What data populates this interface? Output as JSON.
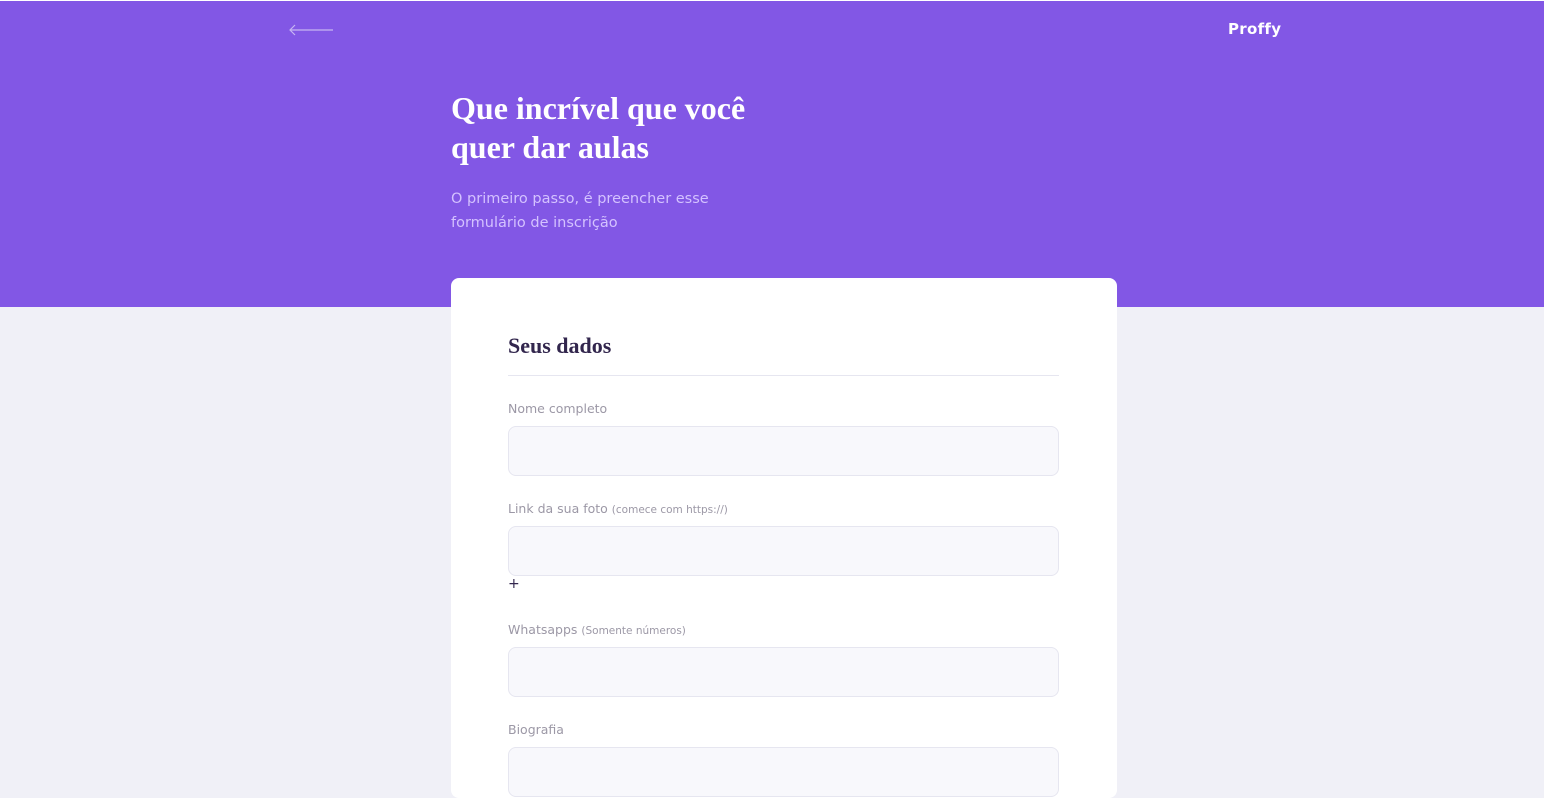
{
  "header": {
    "back_icon": "arrow-left-icon",
    "logo": "Proffy",
    "title_line1": "Que incrível que você",
    "title_line2": "quer dar aulas",
    "subtitle_line1": "O primeiro passo, é preencher esse",
    "subtitle_line2": "formulário de inscrição"
  },
  "form": {
    "section_title": "Seus dados",
    "fields": [
      {
        "label": "Nome completo",
        "hint": "",
        "value": ""
      },
      {
        "label": "Link da sua foto",
        "hint": "(comece com https://)",
        "value": ""
      },
      {
        "label": "Whatsapps",
        "hint": "(Somente números)",
        "value": ""
      },
      {
        "label": "Biografia",
        "hint": "",
        "value": ""
      }
    ],
    "add_label": "+"
  },
  "colors": {
    "primary": "#8257E5",
    "background": "#F0F0F7",
    "card": "#FFFFFF",
    "title_dark": "#32264D",
    "label": "#9C98A6",
    "input_bg": "#F8F8FC",
    "subtitle": "#D4C2FF"
  }
}
